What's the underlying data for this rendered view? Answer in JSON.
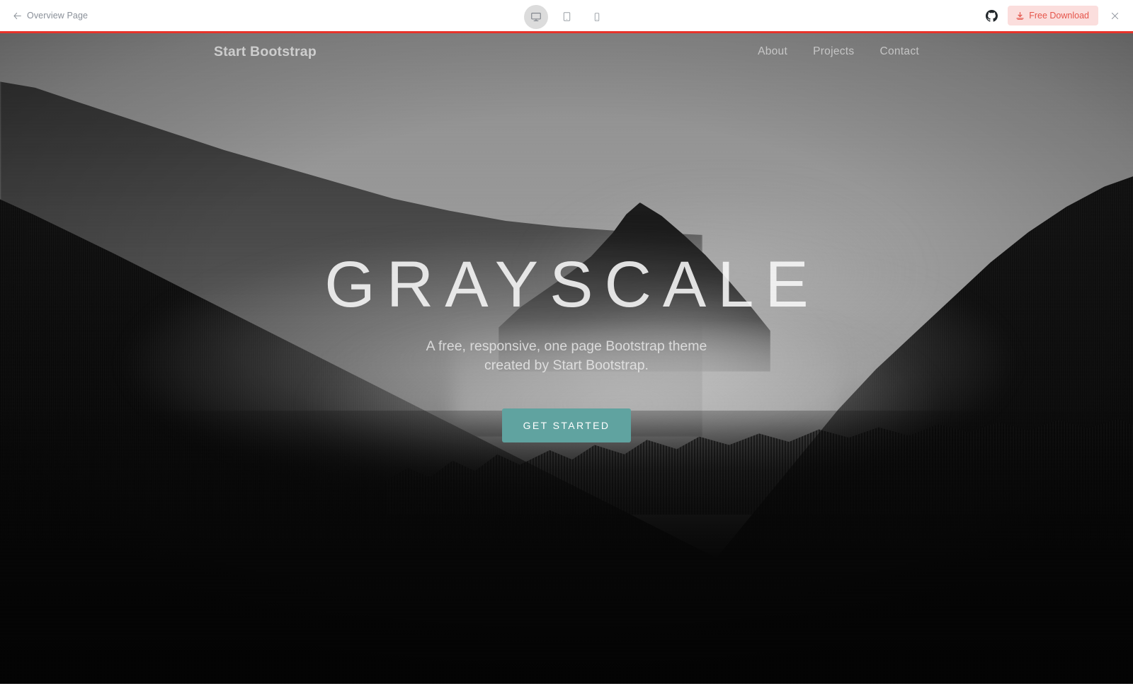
{
  "toolbar": {
    "back_label": "Overview Page",
    "back_icon": "arrow-left-icon",
    "devices": [
      {
        "name": "desktop",
        "icon": "desktop-icon",
        "active": true
      },
      {
        "name": "tablet",
        "icon": "tablet-icon",
        "active": false
      },
      {
        "name": "mobile",
        "icon": "mobile-icon",
        "active": false
      }
    ],
    "github_icon": "github-icon",
    "download_label": "Free Download",
    "download_icon": "download-icon",
    "close_icon": "close-icon",
    "accent_line_color": "#e8332a",
    "download_bg": "#fbdedd",
    "download_fg": "#e5554b"
  },
  "preview": {
    "navbar": {
      "brand": "Start Bootstrap",
      "links": [
        {
          "label": "About"
        },
        {
          "label": "Projects"
        },
        {
          "label": "Contact"
        }
      ]
    },
    "hero": {
      "title": "GRAYSCALE",
      "subtitle": "A free, responsive, one page Bootstrap theme created by Start Bootstrap.",
      "cta_label": "GET STARTED",
      "cta_color": "#60a3a0"
    },
    "background": {
      "description": "grayscale misty forested mountain landscape",
      "sky_color": "#969696",
      "forest_color": "#0a0a0a"
    }
  }
}
